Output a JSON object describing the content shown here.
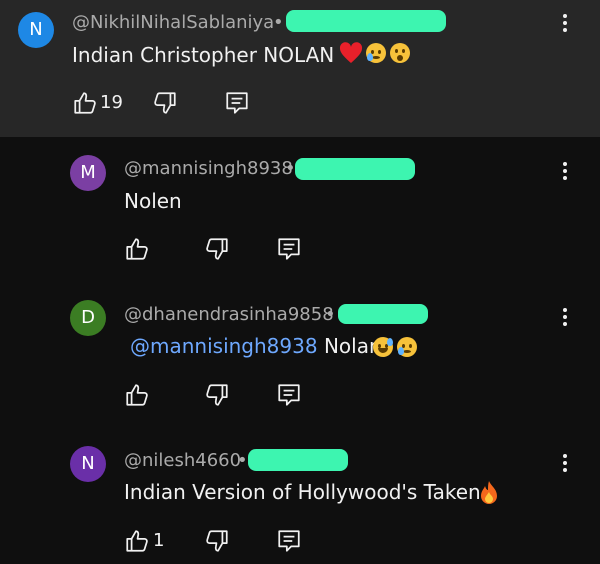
{
  "comments": [
    {
      "avatar_letter": "N",
      "avatar_color": "#1e88e5",
      "handle": "@NikhilNihalSablaniya",
      "sep": "•",
      "text": "Indian Christopher NOLAN",
      "emojis": [
        "red-heart",
        "sad-tear-face",
        "surprised-face"
      ],
      "likes": "19"
    },
    {
      "avatar_letter": "M",
      "avatar_color": "#7b3fa3",
      "handle": "@mannisingh8938",
      "sep": "•",
      "text": "Nolen",
      "likes": ""
    },
    {
      "avatar_letter": "D",
      "avatar_color": "#3b7d23",
      "handle": "@dhanendrasinha9858",
      "sep": "•",
      "mention": "@mannisingh8938",
      "text": "Nolan",
      "emojis": [
        "sweat-smile-face",
        "sad-tear-face"
      ],
      "likes": ""
    },
    {
      "avatar_letter": "N",
      "avatar_color": "#6a2fa8",
      "handle": "@nilesh4660",
      "sep": "•",
      "text": "Indian Version of Hollywood's Taken",
      "emojis": [
        "fire"
      ],
      "likes": "1"
    }
  ],
  "colors": {
    "background": "#0f0f0f",
    "parent_background": "#272727",
    "mention": "#6ea8fe",
    "redaction": "#3df5b0"
  }
}
